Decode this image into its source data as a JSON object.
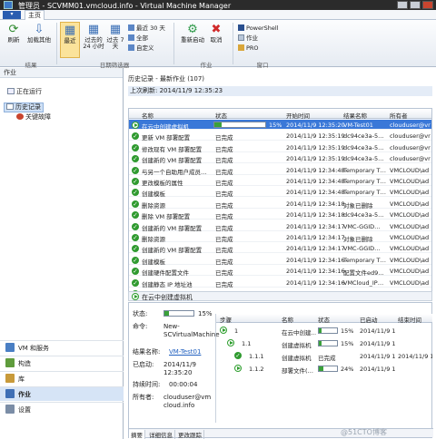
{
  "window": {
    "title": "管理员 - SCVMM01.vmcloud.info - Virtual Machine Manager"
  },
  "ribbon": {
    "file_tab": "",
    "home_tab": "主页",
    "refresh": "刷新",
    "add_other": "加载其他",
    "recent": "最近",
    "past24": "过去的 24 小时",
    "past7": "过去 7 天",
    "last30": "最近 30 天",
    "all": "全部",
    "custom": "自定义",
    "restart": "重新启动",
    "cancel": "取消",
    "powershell": "PowerShell",
    "jobs": "作业",
    "pro": "PRO",
    "group_results": "结果",
    "group_date_filter": "日期筛选器",
    "group_jobs": "作业",
    "group_window": "窗口"
  },
  "left": {
    "pane_title": "作业",
    "nav": [
      {
        "label": "正在运行"
      },
      {
        "label": "历史记录"
      },
      {
        "label": "关键故障"
      }
    ],
    "workspaces": [
      {
        "label": "VM 和服务",
        "color": "#4a7fc4"
      },
      {
        "label": "构造",
        "color": "#5f9c3c"
      },
      {
        "label": "库",
        "color": "#c89a3a"
      },
      {
        "label": "作业",
        "color": "#3f6fb5"
      },
      {
        "label": "设置",
        "color": "#7b8da6"
      }
    ]
  },
  "main": {
    "section_title": "历史记录 - 最新作业 (107)",
    "last_refresh": "上次刷新: 2014/11/9 12:35:23",
    "columns": [
      "名称",
      "状态",
      "开始时间",
      "结果名称",
      "所有者"
    ],
    "rows": [
      {
        "icon": "running",
        "name": "在云中创建虚拟机",
        "status": "15%",
        "progress": 15,
        "start": "2014/11/9 12:35:20",
        "result": "VM-Test01",
        "owner": "clouduser@vr"
      },
      {
        "icon": "done",
        "name": "更新 VM 部署配置",
        "status": "已完成",
        "start": "2014/11/9 12:35:19",
        "result": "dc94ce3a-5…",
        "owner": "clouduser@vr"
      },
      {
        "icon": "done",
        "name": "修改现有 VM 部署配置",
        "status": "已完成",
        "start": "2014/11/9 12:35:19",
        "result": "dc94ce3a-5…",
        "owner": "clouduser@vr"
      },
      {
        "icon": "done",
        "name": "创建新的 VM 部署配置",
        "status": "已完成",
        "start": "2014/11/9 12:35:19",
        "result": "dc94ce3a-5…",
        "owner": "clouduser@vr"
      },
      {
        "icon": "done",
        "name": "与另一个自助用户成员…",
        "status": "已完成",
        "start": "2014/11/9 12:34:48",
        "result": "Temporary T…",
        "owner": "VMCLOUD\\ad"
      },
      {
        "icon": "done",
        "name": "更改模板的属性",
        "status": "已完成",
        "start": "2014/11/9 12:34:48",
        "result": "Temporary T…",
        "owner": "VMCLOUD\\ad"
      },
      {
        "icon": "done",
        "name": "创建模板",
        "status": "已完成",
        "start": "2014/11/9 12:34:48",
        "result": "Temporary T…",
        "owner": "VMCLOUD\\ad"
      },
      {
        "icon": "done",
        "name": "删除资源",
        "status": "已完成",
        "start": "2014/11/9 12:34:18",
        "result": "对象已删除",
        "owner": "VMCLOUD\\ad"
      },
      {
        "icon": "done",
        "name": "删除 VM 部署配置",
        "status": "已完成",
        "start": "2014/11/9 12:34:18",
        "result": "dc94ce3a-5…",
        "owner": "VMCLOUD\\ad"
      },
      {
        "icon": "done",
        "name": "创建新的 VM 部署配置",
        "status": "已完成",
        "start": "2014/11/9 12:34:17",
        "result": "VMC-GGID…",
        "owner": "VMCLOUD\\ad"
      },
      {
        "icon": "done",
        "name": "删除资源",
        "status": "已完成",
        "start": "2014/11/9 12:34:17",
        "result": "对象已删除",
        "owner": "VMCLOUD\\ad"
      },
      {
        "icon": "done",
        "name": "创建新的 VM 部署配置",
        "status": "已完成",
        "start": "2014/11/9 12:34:17",
        "result": "VMC-GGID…",
        "owner": "VMCLOUD\\ad"
      },
      {
        "icon": "done",
        "name": "创建模板",
        "status": "已完成",
        "start": "2014/11/9 12:34:16",
        "result": "Temporary T…",
        "owner": "VMCLOUD\\ad"
      },
      {
        "icon": "done",
        "name": "创建硬件配置文件",
        "status": "已完成",
        "start": "2014/11/9 12:34:16",
        "result": "配置文件ed9…",
        "owner": "VMCLOUD\\ad"
      },
      {
        "icon": "done",
        "name": "创建静态 IP 地址池",
        "status": "已完成",
        "start": "2014/11/9 12:34:16",
        "result": "VMCloud_IP…",
        "owner": "VMCLOUD\\ad"
      },
      {
        "icon": "done",
        "name": "删除资源",
        "status": "已完成",
        "start": "2014/11/9 12:34:16",
        "result": "对象已删除",
        "owner": "VMCLOUD\\ad"
      }
    ]
  },
  "detail": {
    "header": "在云中创建虚拟机",
    "status_label": "状态:",
    "status_value": "15%",
    "progress": 15,
    "command_label": "命令:",
    "command_value": "New-SCVirtualMachine",
    "result_label": "结果名称:",
    "result_value": "VM-Test01",
    "started_label": "已启动:",
    "started_value": "2014/11/9 12:35:20",
    "duration_label": "持续时间:",
    "duration_value": "00:00:04",
    "owner_label": "所有者:",
    "owner_value": "clouduser@vmcloud.info",
    "step_columns": [
      "步骤",
      "名称",
      "状态",
      "已启动",
      "结束时间"
    ],
    "steps": [
      {
        "step": "1",
        "name": "在云中创建…",
        "status": "15%",
        "progress": 15,
        "started": "2014/11/9 1…",
        "ended": ""
      },
      {
        "step": "1.1",
        "name": "创建虚拟机",
        "status": "15%",
        "progress": 15,
        "started": "2014/11/9 1…",
        "ended": ""
      },
      {
        "step": "1.1.1",
        "name": "创建虚拟机",
        "status": "已完成",
        "progress": 100,
        "started": "2014/11/9 1…",
        "ended": "2014/11/9 1…"
      },
      {
        "step": "1.1.2",
        "name": "部署文件(…",
        "status": "24%",
        "progress": 24,
        "started": "2014/11/9 1…",
        "ended": ""
      }
    ],
    "tabs": [
      "摘要",
      "详细信息",
      "更改跟踪"
    ]
  },
  "watermark": "@51CTO博客"
}
